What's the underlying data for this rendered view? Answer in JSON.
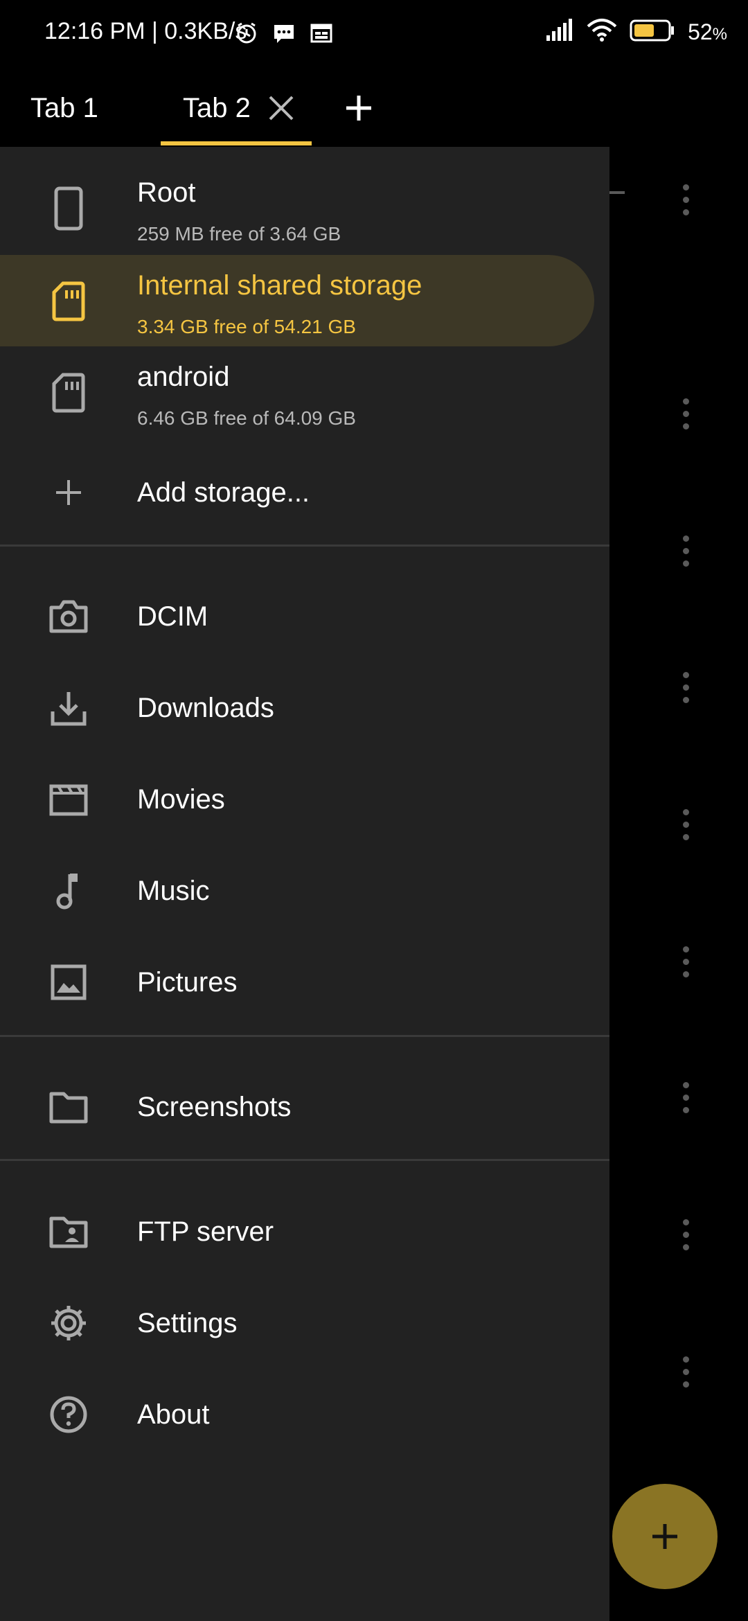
{
  "status_bar": {
    "time": "12:16 PM",
    "speed": "0.3KB/s",
    "battery": "52",
    "battery_unit": "%",
    "icons": [
      "alarm-icon",
      "message-icon",
      "calendar-icon",
      "signal-icon",
      "wifi-icon",
      "battery-icon"
    ]
  },
  "tabs": {
    "tab1_label": "Tab 1",
    "tab2_label": "Tab 2",
    "active_tab": "Tab 2",
    "accent": "#f5c542"
  },
  "drawer": {
    "storages": [
      {
        "title": "Root",
        "sub": "259 MB free of 3.64 GB",
        "icon": "phone-icon"
      },
      {
        "title": "Internal shared storage",
        "sub": "3.34 GB free of 54.21 GB",
        "icon": "sd-card-icon",
        "active": true
      },
      {
        "title": "android",
        "sub": "6.46 GB free of 64.09 GB",
        "icon": "sd-card-icon"
      }
    ],
    "add_storage": "Add storage...",
    "folders": [
      {
        "label": "DCIM",
        "icon": "camera-icon"
      },
      {
        "label": "Downloads",
        "icon": "download-icon"
      },
      {
        "label": "Movies",
        "icon": "movie-icon"
      },
      {
        "label": "Music",
        "icon": "music-icon"
      },
      {
        "label": "Pictures",
        "icon": "image-icon"
      }
    ],
    "bookmarks": [
      {
        "label": "Screenshots",
        "icon": "folder-icon"
      }
    ],
    "menu": [
      {
        "label": "FTP server",
        "icon": "ftp-folder-icon"
      },
      {
        "label": "Settings",
        "icon": "gear-icon"
      },
      {
        "label": "About",
        "icon": "help-icon"
      }
    ]
  },
  "fab": {
    "icon": "plus-icon",
    "color": "#8a7424"
  }
}
